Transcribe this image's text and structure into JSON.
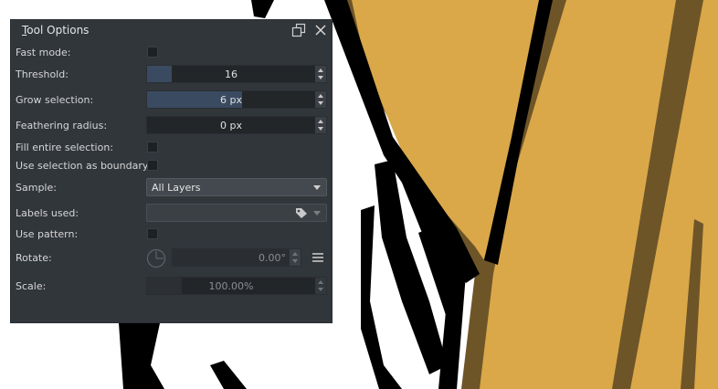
{
  "panel": {
    "title_prefix": "",
    "title_mnemonic": "T",
    "title_rest": "ool Options"
  },
  "options": {
    "fast_mode": {
      "label": "Fast mode:",
      "checked": false
    },
    "threshold": {
      "label": "Threshold:",
      "value": "16",
      "fill_fraction": 0.14
    },
    "grow_selection": {
      "label": "Grow selection:",
      "value": "6 px",
      "fill_fraction": 0.53
    },
    "feathering_radius": {
      "label": "Feathering radius:",
      "value": "0 px",
      "fill_fraction": 0.0
    },
    "fill_entire_selection": {
      "label": "Fill entire selection:",
      "checked": false
    },
    "use_selection_as_boundary": {
      "label": "Use selection as boundary:",
      "checked": false
    },
    "sample": {
      "label": "Sample:",
      "value": "All Layers"
    },
    "labels_used": {
      "label": "Labels used:",
      "value": ""
    },
    "use_pattern": {
      "label": "Use pattern:",
      "checked": false
    },
    "rotate": {
      "label": "Rotate:",
      "value": "0.00°"
    },
    "scale": {
      "label": "Scale:",
      "value": "100.00%"
    }
  },
  "icons": {
    "float": "float-window-icon",
    "close": "close-icon",
    "tag": "tag-icon",
    "rotate_dial": "rotation-dial-icon",
    "menu": "hamburger-menu-icon"
  },
  "colors": {
    "panel_bg": "#31363b",
    "accent_fill": "#3a4a60",
    "canvas_fill": "#daa849",
    "canvas_shadow": "#6e5528",
    "canvas_ink": "#000000"
  }
}
